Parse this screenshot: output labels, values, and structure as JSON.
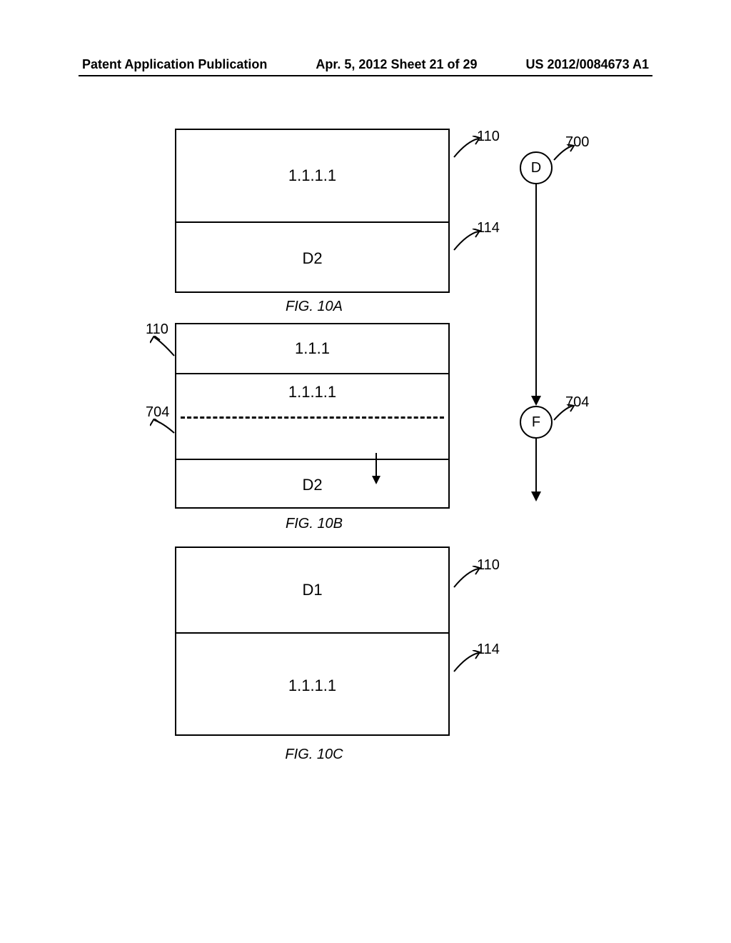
{
  "header": {
    "left": "Patent Application Publication",
    "center": "Apr. 5, 2012  Sheet 21 of 29",
    "right": "US 2012/0084673 A1"
  },
  "fig10a": {
    "top": "1.1.1.1",
    "bottom": "D2",
    "caption": "FIG. 10A",
    "ref_top": "110",
    "ref_bottom": "114",
    "ref_node": "700"
  },
  "fig10b": {
    "row1": "1.1.1",
    "row2": "1.1.1.1",
    "row3": "D2",
    "caption": "FIG. 10B",
    "ref_left_top": "110",
    "ref_left_mid": "704",
    "ref_node_right": "704"
  },
  "fig10c": {
    "top": "D1",
    "bottom": "1.1.1.1",
    "caption": "FIG. 10C",
    "ref_top": "110",
    "ref_bottom": "114"
  },
  "nodes": {
    "d": "D",
    "f": "F"
  }
}
